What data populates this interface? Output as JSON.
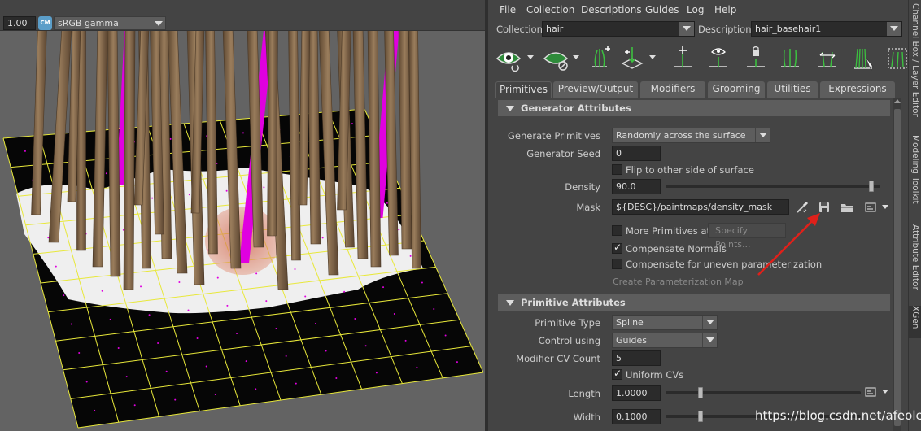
{
  "viewport": {
    "gamma_value": "1.00",
    "colormanage_label": "CM",
    "colorspace": "sRGB gamma"
  },
  "menu": [
    "File",
    "Collection",
    "Descriptions",
    "Guides",
    "Log",
    "Help"
  ],
  "collection": {
    "label": "Collection",
    "value": "hair"
  },
  "description": {
    "label": "Description",
    "value": "hair_basehair1"
  },
  "toolbar_icons": [
    "select-guides-icon",
    "hide-guides-icon",
    "add-guide-icon",
    "move-guide-icon",
    "bend-guide-icon",
    "show-guide-icon",
    "lock-guide-icon",
    "normalize-guide-icon",
    "flip-guide-icon",
    "rebuild-guide-icon",
    "sculpt-guide-icon"
  ],
  "tabs": [
    "Primitives",
    "Preview/Output",
    "Modifiers",
    "Grooming",
    "Utilities",
    "Expressions"
  ],
  "generator": {
    "header": "Generator Attributes",
    "generate_label": "Generate Primitives",
    "generate_value": "Randomly across the surface",
    "seed_label": "Generator Seed",
    "seed_value": "0",
    "flip_label": "Flip to other side of surface",
    "density_label": "Density",
    "density_value": "90.0",
    "density_fraction": 0.96,
    "mask_label": "Mask",
    "mask_value": "${DESC}/paintmaps/density_mask",
    "more_label": "More Primitives at",
    "specify_label": "Specify Points...",
    "comp_normals_label": "Compensate Normals",
    "comp_uneven_label": "Compensate for uneven parameterization",
    "create_param_label": "Create Parameterization Map"
  },
  "primitive": {
    "header": "Primitive Attributes",
    "type_label": "Primitive Type",
    "type_value": "Spline",
    "control_label": "Control using",
    "control_value": "Guides",
    "cv_label": "Modifier CV Count",
    "cv_value": "5",
    "uniform_label": "Uniform CVs",
    "length_label": "Length",
    "length_value": "1.0000",
    "length_fraction": 0.18,
    "width_label": "Width",
    "width_value": "0.1000",
    "width_fraction": 0.18
  },
  "side_tabs": [
    "Channel Box / Layer Editor",
    "Modeling Toolkit",
    "Attribute Editor",
    "XGen"
  ],
  "watermark": "https://blog.csdn.net/afeoler",
  "colors": {
    "accent_red": "#e0201a",
    "magenta": "#e000e0",
    "hair_brown": "#8a6e4e",
    "grid_yellow": "#e8e83a"
  }
}
